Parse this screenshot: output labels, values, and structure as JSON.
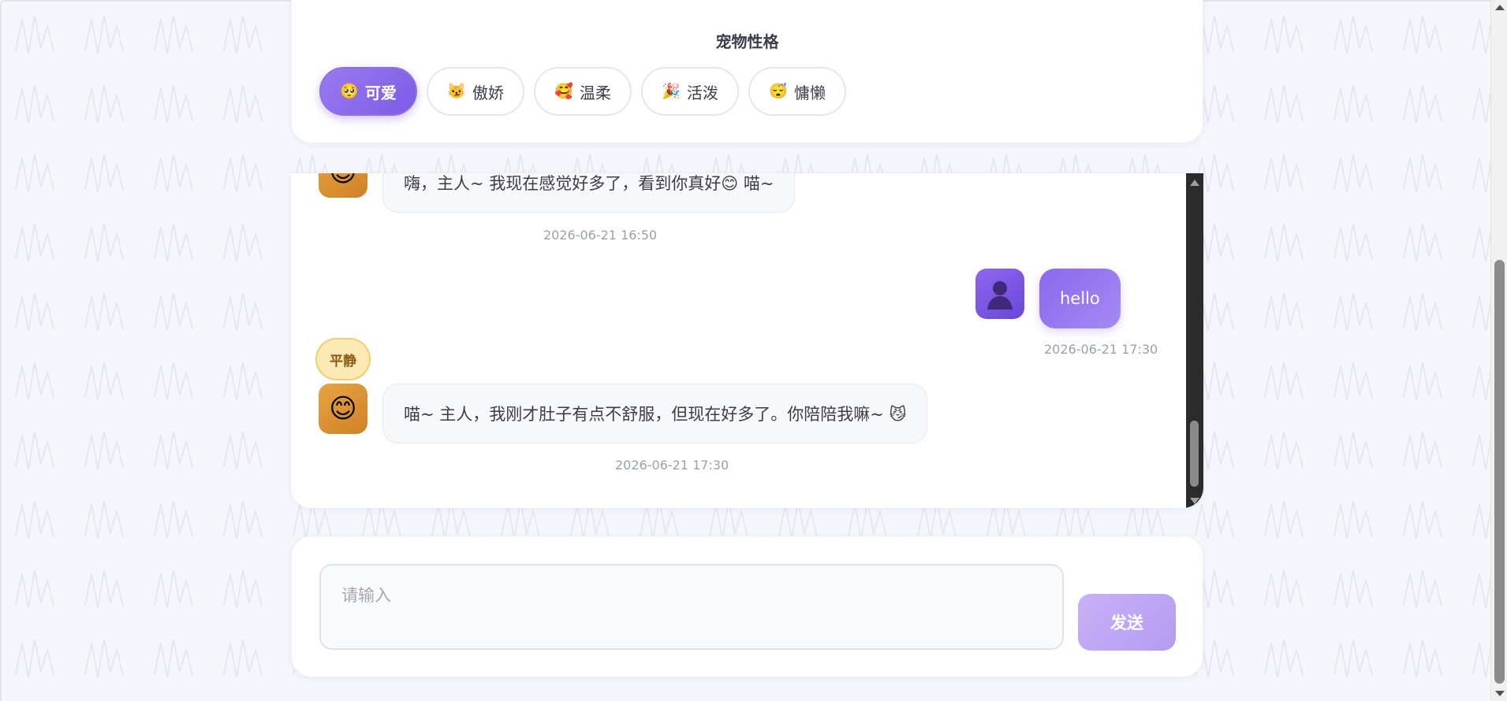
{
  "personality": {
    "title": "宠物性格",
    "options": [
      {
        "emoji": "🥺",
        "label": "可爱",
        "active": true
      },
      {
        "emoji": "😼",
        "label": "傲娇",
        "active": false
      },
      {
        "emoji": "🥰",
        "label": "温柔",
        "active": false
      },
      {
        "emoji": "🎉",
        "label": "活泼",
        "active": false
      },
      {
        "emoji": "😴",
        "label": "慵懒",
        "active": false
      }
    ]
  },
  "chat": {
    "messages": [
      {
        "sender": "pet",
        "avatar": "😊",
        "text": "嗨，主人~ 我现在感觉好多了，看到你真好😊 喵~",
        "time": "2026-06-21 16:50"
      },
      {
        "sender": "user",
        "avatar": "👤",
        "text": "hello",
        "time": "2026-06-21 17:30"
      },
      {
        "sender": "pet",
        "mood": "平静",
        "avatar": "😊",
        "text": "喵~ 主人，我刚才肚子有点不舒服，但现在好多了。你陪陪我嘛~ 😼",
        "time": "2026-06-21 17:30"
      }
    ]
  },
  "composer": {
    "placeholder": "请输入",
    "value": "",
    "send_label": "发送"
  },
  "colors": {
    "accent": "#7b5ce6",
    "pet_avatar": "#d98a2c",
    "mood_badge": "#fde9b3",
    "send_button": "#bfa6f4"
  },
  "icons": {
    "user_avatar": "user-silhouette-icon",
    "pet_avatar": "smiling-face-icon"
  }
}
